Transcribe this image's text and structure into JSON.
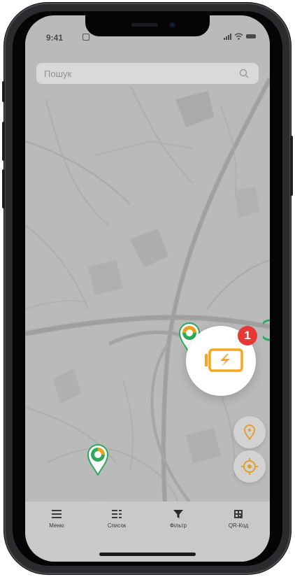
{
  "status_bar": {
    "time": "9:41"
  },
  "search": {
    "placeholder": "Пошук"
  },
  "map": {
    "notification_count": "1",
    "colors": {
      "marker_green": "#2eaa5c",
      "marker_orange": "#f0a020",
      "charge_orange": "#f7a51b",
      "badge_red": "#e53935"
    }
  },
  "tabbar": {
    "items": [
      {
        "label": "Меню",
        "icon": "menu-icon"
      },
      {
        "label": "Список",
        "icon": "list-icon"
      },
      {
        "label": "Фільтр",
        "icon": "filter-icon"
      },
      {
        "label": "QR-Код",
        "icon": "qr-code-icon"
      }
    ]
  }
}
